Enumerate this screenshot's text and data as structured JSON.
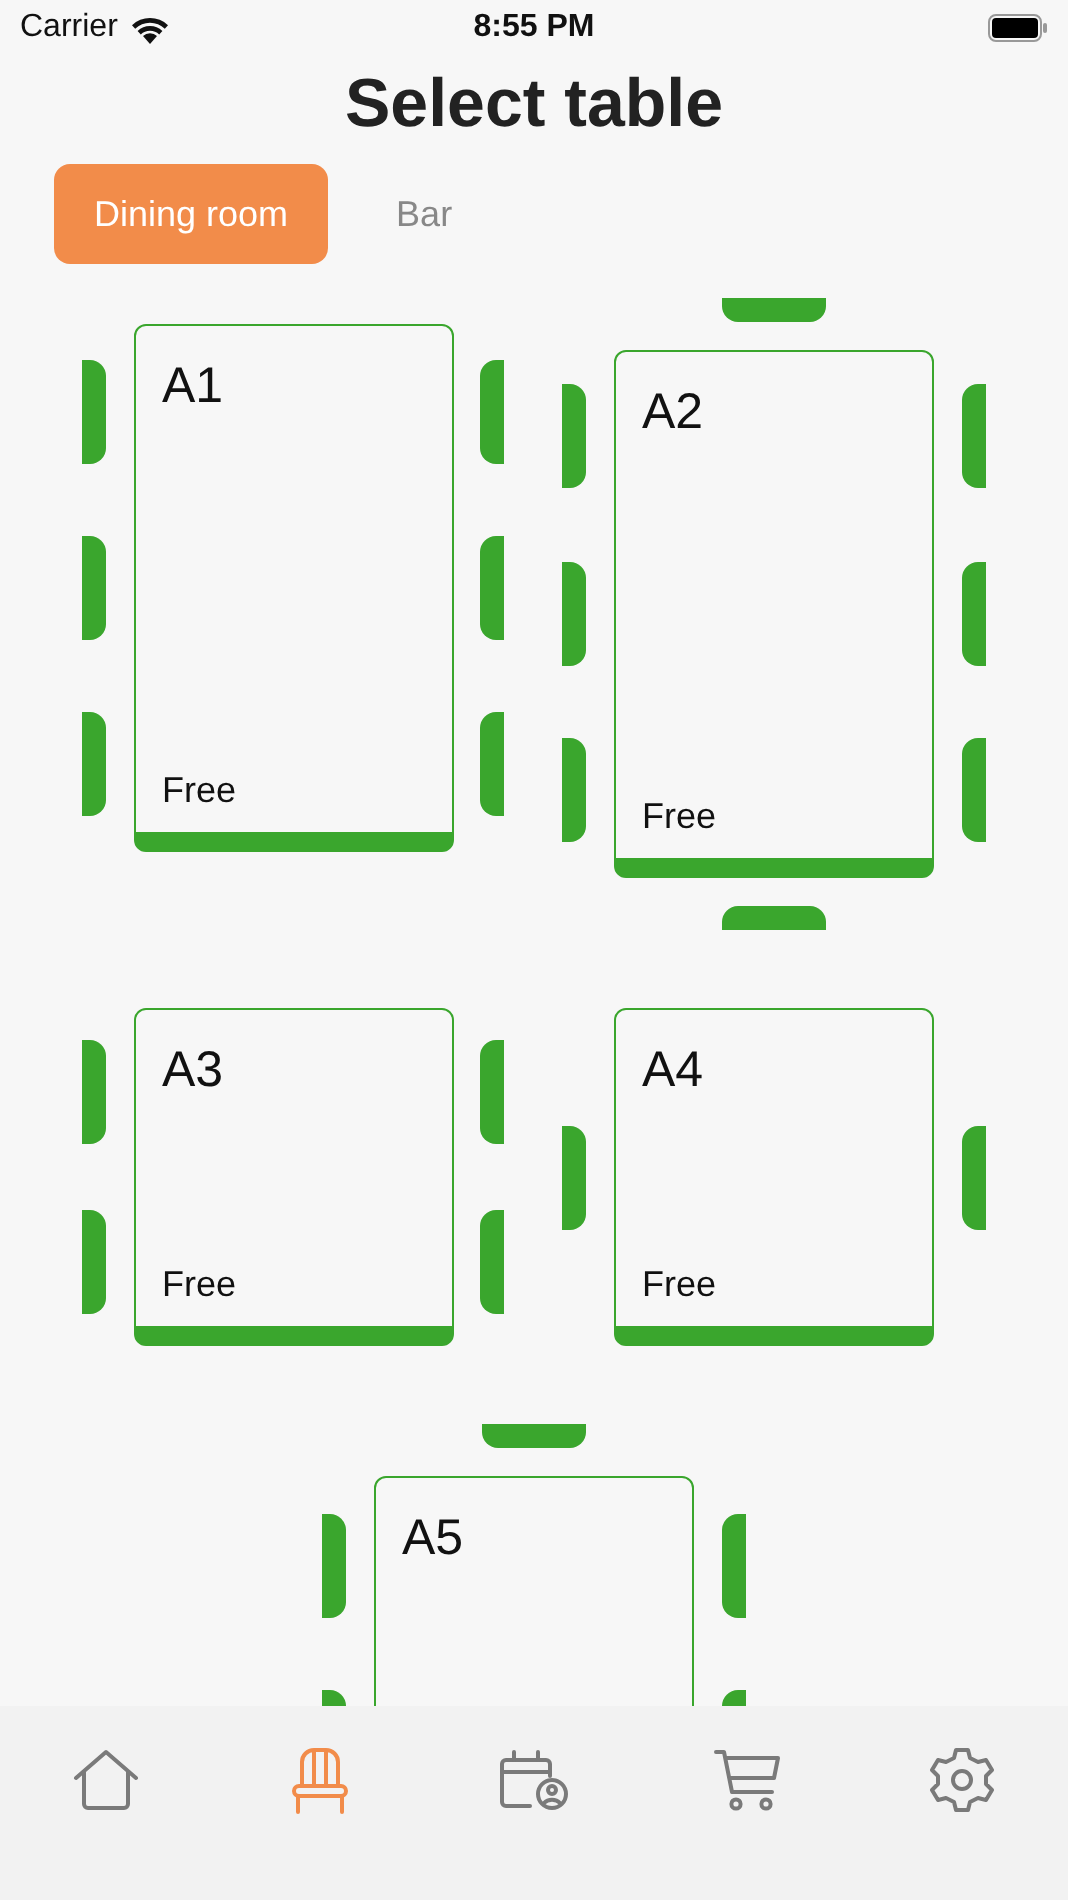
{
  "status_bar": {
    "carrier": "Carrier",
    "time": "8:55 PM"
  },
  "title": "Select table",
  "tabs": [
    {
      "label": "Dining room",
      "selected": true
    },
    {
      "label": "Bar",
      "selected": false
    }
  ],
  "tables": [
    {
      "name": "A1",
      "status": "Free"
    },
    {
      "name": "A2",
      "status": "Free"
    },
    {
      "name": "A3",
      "status": "Free"
    },
    {
      "name": "A4",
      "status": "Free"
    },
    {
      "name": "A5"
    }
  ],
  "nav": [
    {
      "kind": "home",
      "selected": false
    },
    {
      "kind": "chair",
      "selected": true
    },
    {
      "kind": "calendar",
      "selected": false
    },
    {
      "kind": "cart",
      "selected": false
    },
    {
      "kind": "settings",
      "selected": false
    }
  ]
}
